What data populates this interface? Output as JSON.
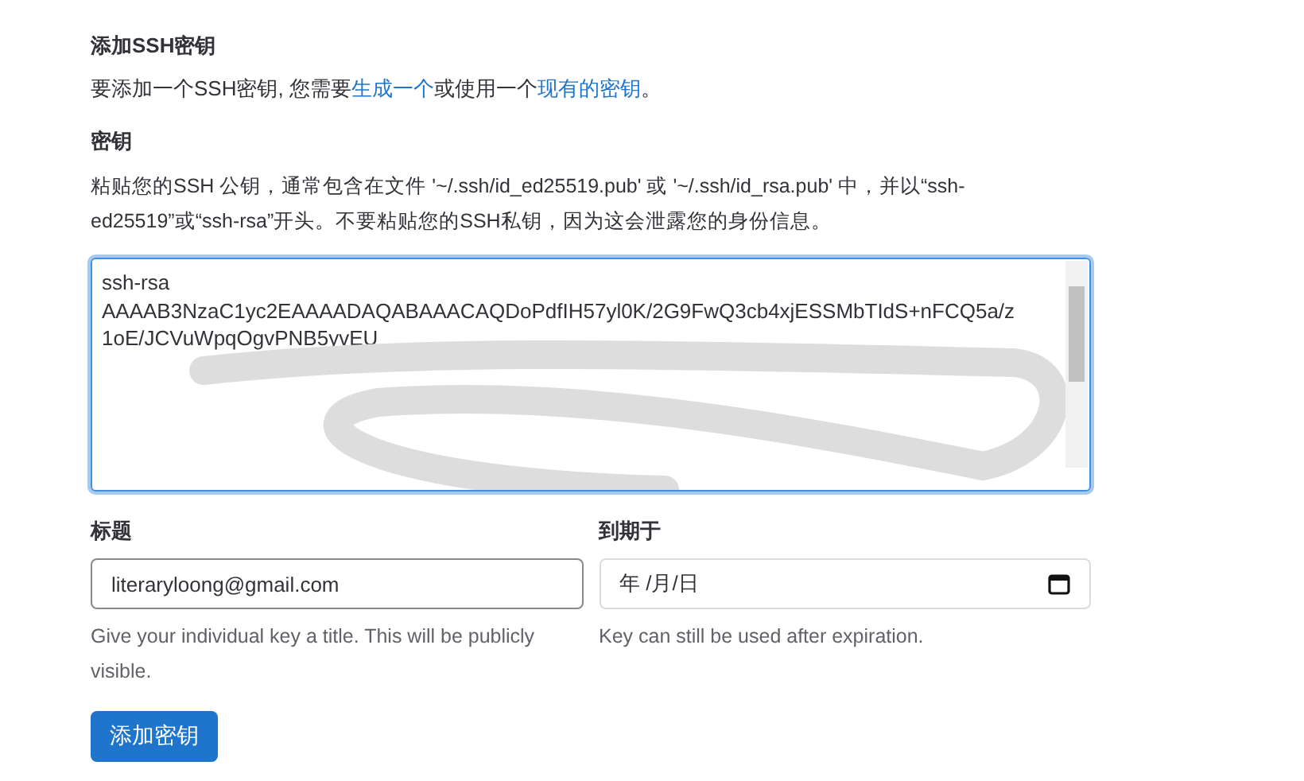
{
  "heading": "添加SSH密钥",
  "intro": {
    "before": "要添加一个SSH密钥, 您需要",
    "link_1": "生成一个",
    "middle": "或使用一个",
    "link_2": "现有的密钥",
    "after": "。"
  },
  "key": {
    "label": "密钥",
    "help": "粘贴您的SSH 公钥，通常包含在文件 '~/.ssh/id_ed25519.pub' 或 '~/.ssh/id_rsa.pub' 中，并以“ssh-ed25519”或“ssh-rsa”开头。不要粘贴您的SSH私钥，因为这会泄露您的身份信息。",
    "value_lines": [
      "ssh-rsa",
      "AAAAB3NzaC1yc2EAAAADAQABAAACAQDoPdfIH57yl0K/2G9FwQ3cb4xjESSMbTIdS+nFCQ5a/z",
      "1oE/JCVuWpqOgvPNB5yvEU"
    ]
  },
  "title_field": {
    "label": "标题",
    "value": "literaryloong@gmail.com",
    "help": "Give your individual key a title. This will be publicly visible."
  },
  "expiry_field": {
    "label": "到期于",
    "value": "年 /月/日",
    "help": "Key can still be used after expiration."
  },
  "submit_button": "添加密钥"
}
